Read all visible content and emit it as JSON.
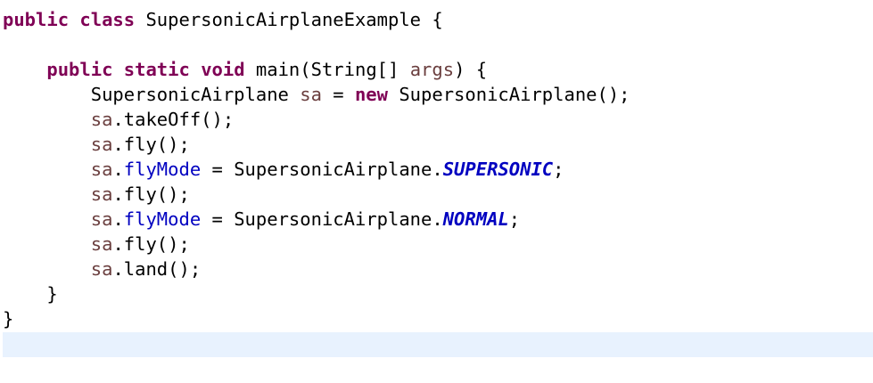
{
  "editor": {
    "theme": {
      "background": "#ffffff",
      "current_line": "#e8f2fe",
      "keyword": "#7f0055",
      "plain": "#000000",
      "local_variable": "#6a3e3e",
      "field": "#0000c0",
      "static_field": "#0000c0"
    },
    "lines": [
      [
        {
          "text": "public",
          "type": "kw"
        },
        {
          "text": " ",
          "type": "plain"
        },
        {
          "text": "class",
          "type": "kw"
        },
        {
          "text": " SupersonicAirplaneExample {",
          "type": "plain"
        }
      ],
      [],
      [
        {
          "text": "    ",
          "type": "plain"
        },
        {
          "text": "public",
          "type": "kw"
        },
        {
          "text": " ",
          "type": "plain"
        },
        {
          "text": "static",
          "type": "kw"
        },
        {
          "text": " ",
          "type": "plain"
        },
        {
          "text": "void",
          "type": "kw"
        },
        {
          "text": " main(String[] ",
          "type": "plain"
        },
        {
          "text": "args",
          "type": "local"
        },
        {
          "text": ") {",
          "type": "plain"
        }
      ],
      [
        {
          "text": "        SupersonicAirplane ",
          "type": "plain"
        },
        {
          "text": "sa",
          "type": "local"
        },
        {
          "text": " = ",
          "type": "plain"
        },
        {
          "text": "new",
          "type": "kw"
        },
        {
          "text": " SupersonicAirplane();",
          "type": "plain"
        }
      ],
      [
        {
          "text": "        ",
          "type": "plain"
        },
        {
          "text": "sa",
          "type": "local"
        },
        {
          "text": ".takeOff();",
          "type": "plain"
        }
      ],
      [
        {
          "text": "        ",
          "type": "plain"
        },
        {
          "text": "sa",
          "type": "local"
        },
        {
          "text": ".fly();",
          "type": "plain"
        }
      ],
      [
        {
          "text": "        ",
          "type": "plain"
        },
        {
          "text": "sa",
          "type": "local"
        },
        {
          "text": ".",
          "type": "plain"
        },
        {
          "text": "flyMode",
          "type": "field"
        },
        {
          "text": " = SupersonicAirplane.",
          "type": "plain"
        },
        {
          "text": "SUPERSONIC",
          "type": "static"
        },
        {
          "text": ";",
          "type": "plain"
        }
      ],
      [
        {
          "text": "        ",
          "type": "plain"
        },
        {
          "text": "sa",
          "type": "local"
        },
        {
          "text": ".fly();",
          "type": "plain"
        }
      ],
      [
        {
          "text": "        ",
          "type": "plain"
        },
        {
          "text": "sa",
          "type": "local"
        },
        {
          "text": ".",
          "type": "plain"
        },
        {
          "text": "flyMode",
          "type": "field"
        },
        {
          "text": " = SupersonicAirplane.",
          "type": "plain"
        },
        {
          "text": "NORMAL",
          "type": "static"
        },
        {
          "text": ";",
          "type": "plain"
        }
      ],
      [
        {
          "text": "        ",
          "type": "plain"
        },
        {
          "text": "sa",
          "type": "local"
        },
        {
          "text": ".fly();",
          "type": "plain"
        }
      ],
      [
        {
          "text": "        ",
          "type": "plain"
        },
        {
          "text": "sa",
          "type": "local"
        },
        {
          "text": ".land();",
          "type": "plain"
        }
      ],
      [
        {
          "text": "    }",
          "type": "plain"
        }
      ],
      [
        {
          "text": "}",
          "type": "plain"
        }
      ],
      []
    ]
  }
}
